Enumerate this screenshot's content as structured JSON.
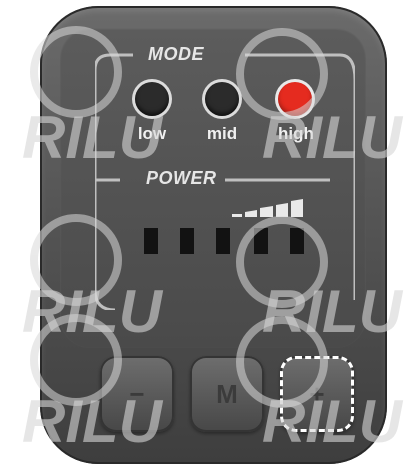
{
  "mode": {
    "title": "MODE",
    "leds": [
      {
        "label": "low",
        "state": "off",
        "color": "#2b2b2b"
      },
      {
        "label": "mid",
        "state": "off",
        "color": "#2b2b2b"
      },
      {
        "label": "high",
        "state": "on",
        "color": "#e52b1f"
      }
    ]
  },
  "power": {
    "title": "POWER",
    "bars": 5
  },
  "buttons": [
    {
      "label": "−",
      "name": "minus-button"
    },
    {
      "label": "M",
      "name": "mode-button"
    },
    {
      "label": "+",
      "name": "plus-button",
      "highlighted": true
    }
  ],
  "watermark": {
    "text": "RILU"
  }
}
